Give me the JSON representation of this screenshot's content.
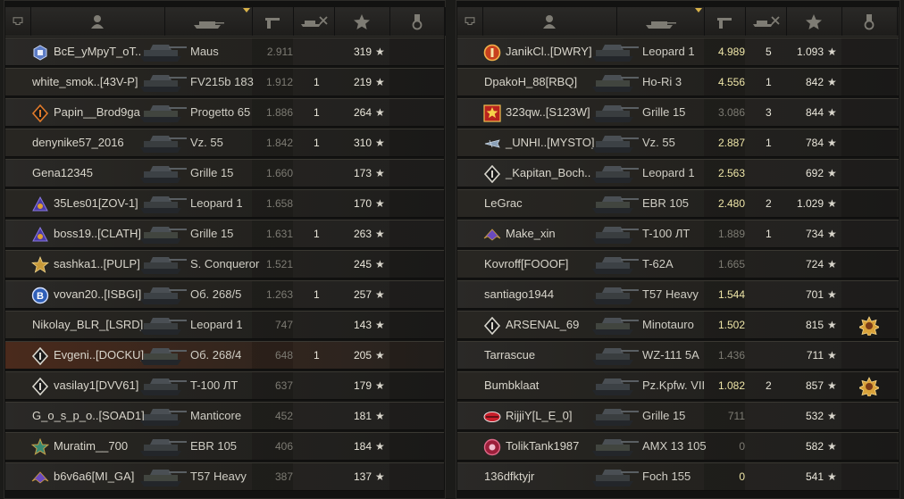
{
  "teams": [
    {
      "id": "left",
      "players": [
        {
          "name": "BcE_yMpyT_oT..",
          "badge": "cube",
          "tank": "Maus",
          "damage": "2.911",
          "dmg_tone": "low",
          "kills": "",
          "xp": "319",
          "medal": false,
          "hl": false
        },
        {
          "name": "white_smok..[43V-P]",
          "badge": "",
          "tank": "FV215b 183",
          "damage": "1.912",
          "dmg_tone": "low",
          "kills": "1",
          "xp": "219",
          "medal": false,
          "hl": false
        },
        {
          "name": "Papin__Brod9ga",
          "badge": "diamond-orange",
          "tank": "Progetto 65",
          "damage": "1.886",
          "dmg_tone": "low",
          "kills": "1",
          "xp": "264",
          "medal": false,
          "hl": false
        },
        {
          "name": "denynike57_2016",
          "badge": "",
          "tank": "Vz. 55",
          "damage": "1.842",
          "dmg_tone": "low",
          "kills": "1",
          "xp": "310",
          "medal": false,
          "hl": false
        },
        {
          "name": "Gena12345",
          "badge": "",
          "tank": "Grille 15",
          "damage": "1.660",
          "dmg_tone": "low",
          "kills": "",
          "xp": "173",
          "medal": false,
          "hl": false
        },
        {
          "name": "35Les01[ZOV-1]",
          "badge": "shield-purple",
          "tank": "Leopard 1",
          "damage": "1.658",
          "dmg_tone": "low",
          "kills": "",
          "xp": "170",
          "medal": false,
          "hl": false
        },
        {
          "name": "boss19..[CLATH]",
          "badge": "shield-purple",
          "tank": "Grille 15",
          "damage": "1.631",
          "dmg_tone": "low",
          "kills": "1",
          "xp": "263",
          "medal": false,
          "hl": false
        },
        {
          "name": "sashka1..[PULP]",
          "badge": "star-gold",
          "tank": "S. Conqueror",
          "damage": "1.521",
          "dmg_tone": "low",
          "kills": "",
          "xp": "245",
          "medal": false,
          "hl": false
        },
        {
          "name": "vovan20..[ISBGI]",
          "badge": "circle-blue",
          "tank": "Об. 268/5",
          "damage": "1.263",
          "dmg_tone": "low",
          "kills": "1",
          "xp": "257",
          "medal": false,
          "hl": false
        },
        {
          "name": "Nikolay_BLR_[LSRD]",
          "badge": "",
          "tank": "Leopard 1",
          "damage": "747",
          "dmg_tone": "low",
          "kills": "",
          "xp": "143",
          "medal": false,
          "hl": false
        },
        {
          "name": "Evgeni..[DOCKU]",
          "badge": "diamond-white",
          "tank": "Об. 268/4",
          "damage": "648",
          "dmg_tone": "low",
          "kills": "1",
          "xp": "205",
          "medal": false,
          "hl": true
        },
        {
          "name": "vasilay1[DVV61]",
          "badge": "diamond-white",
          "tank": "T-100 ЛТ",
          "damage": "637",
          "dmg_tone": "low",
          "kills": "",
          "xp": "179",
          "medal": false,
          "hl": false
        },
        {
          "name": "G_o_s_p_o..[SOAD1]",
          "badge": "",
          "tank": "Manticore",
          "damage": "452",
          "dmg_tone": "low",
          "kills": "",
          "xp": "181",
          "medal": false,
          "hl": false
        },
        {
          "name": "Muratim__700",
          "badge": "star-green",
          "tank": "EBR 105",
          "damage": "406",
          "dmg_tone": "low",
          "kills": "",
          "xp": "184",
          "medal": false,
          "hl": false
        },
        {
          "name": "b6v6a6[MI_GA]",
          "badge": "wings-purple",
          "tank": "T57 Heavy",
          "damage": "387",
          "dmg_tone": "low",
          "kills": "",
          "xp": "137",
          "medal": false,
          "hl": false
        }
      ]
    },
    {
      "id": "right",
      "players": [
        {
          "name": "JanikCl..[DWRY]",
          "badge": "circle-orange",
          "tank": "Leopard 1",
          "damage": "4.989",
          "dmg_tone": "bright",
          "kills": "5",
          "xp": "1.093",
          "medal": false,
          "hl": false
        },
        {
          "name": "DpakoH_88[RBQ]",
          "badge": "",
          "tank": "Ho-Ri 3",
          "damage": "4.556",
          "dmg_tone": "bright",
          "kills": "1",
          "xp": "842",
          "medal": false,
          "hl": false
        },
        {
          "name": "323qw..[S123W]",
          "badge": "star-red",
          "tank": "Grille 15",
          "damage": "3.086",
          "dmg_tone": "low",
          "kills": "3",
          "xp": "844",
          "medal": false,
          "hl": false
        },
        {
          "name": "_UNHI..[MYSTO]",
          "badge": "plane",
          "tank": "Vz. 55",
          "damage": "2.887",
          "dmg_tone": "bright",
          "kills": "1",
          "xp": "784",
          "medal": false,
          "hl": false
        },
        {
          "name": "_Kapitan_Boch..",
          "badge": "diamond-white",
          "tank": "Leopard 1",
          "damage": "2.563",
          "dmg_tone": "bright",
          "kills": "",
          "xp": "692",
          "medal": false,
          "hl": false
        },
        {
          "name": "LeGrac",
          "badge": "",
          "tank": "EBR 105",
          "damage": "2.480",
          "dmg_tone": "bright",
          "kills": "2",
          "xp": "1.029",
          "medal": false,
          "hl": false
        },
        {
          "name": "Make_xin",
          "badge": "wings-purple",
          "tank": "T-100 ЛТ",
          "damage": "1.889",
          "dmg_tone": "low",
          "kills": "1",
          "xp": "734",
          "medal": false,
          "hl": false
        },
        {
          "name": "Kovroff[FOOOF]",
          "badge": "",
          "tank": "T-62A",
          "damage": "1.665",
          "dmg_tone": "low",
          "kills": "",
          "xp": "724",
          "medal": false,
          "hl": false
        },
        {
          "name": "santiago1944",
          "badge": "",
          "tank": "T57 Heavy",
          "damage": "1.544",
          "dmg_tone": "bright",
          "kills": "",
          "xp": "701",
          "medal": false,
          "hl": false
        },
        {
          "name": "ARSENAL_69",
          "badge": "diamond-white",
          "tank": "Minotauro",
          "damage": "1.502",
          "dmg_tone": "bright",
          "kills": "",
          "xp": "815",
          "medal": true,
          "hl": false
        },
        {
          "name": "Tarrascue",
          "badge": "",
          "tank": "WZ-111 5A",
          "damage": "1.436",
          "dmg_tone": "low",
          "kills": "",
          "xp": "711",
          "medal": false,
          "hl": false
        },
        {
          "name": "Bumbklaat",
          "badge": "",
          "tank": "Pz.Kpfw. VII",
          "damage": "1.082",
          "dmg_tone": "bright",
          "kills": "2",
          "xp": "857",
          "medal": true,
          "hl": false
        },
        {
          "name": "RijjiY[L_E_0]",
          "badge": "lips-red",
          "tank": "Grille 15",
          "damage": "711",
          "dmg_tone": "low",
          "kills": "",
          "xp": "532",
          "medal": false,
          "hl": false
        },
        {
          "name": "TolikTank1987",
          "badge": "circle-red",
          "tank": "AMX 13 105",
          "damage": "0",
          "dmg_tone": "low",
          "kills": "",
          "xp": "582",
          "medal": false,
          "hl": false
        },
        {
          "name": "136dfktyjr",
          "badge": "",
          "tank": "Foch 155",
          "damage": "0",
          "dmg_tone": "bright",
          "kills": "",
          "xp": "541",
          "medal": false,
          "hl": false
        }
      ]
    }
  ],
  "star_glyph": "★",
  "colors": {
    "bright": "#efe6a8",
    "low": "#7d7b73",
    "highlight": "#4a2a1c",
    "medal": "#d9a23a"
  }
}
